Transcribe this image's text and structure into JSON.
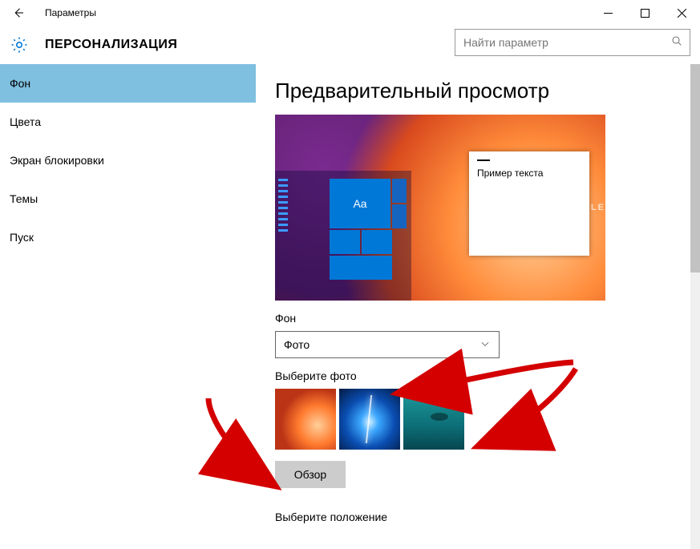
{
  "window": {
    "title": "Параметры"
  },
  "header": {
    "page": "ПЕРСОНАЛИЗАЦИЯ"
  },
  "search": {
    "placeholder": "Найти параметр"
  },
  "sidebar": {
    "items": [
      {
        "label": "Фон",
        "selected": true
      },
      {
        "label": "Цвета",
        "selected": false
      },
      {
        "label": "Экран блокировки",
        "selected": false
      },
      {
        "label": "Темы",
        "selected": false
      },
      {
        "label": "Пуск",
        "selected": false
      }
    ]
  },
  "content": {
    "preview_heading": "Предварительный просмотр",
    "sample_text": "Пример текста",
    "aa_label": "Aa",
    "bg_label": "Фон",
    "bg_dropdown_value": "Фото",
    "choose_photo_label": "Выберите фото",
    "browse_label": "Обзор",
    "choose_fit_label": "Выберите положение"
  },
  "annotation": {
    "arrow_color": "#d40000"
  }
}
